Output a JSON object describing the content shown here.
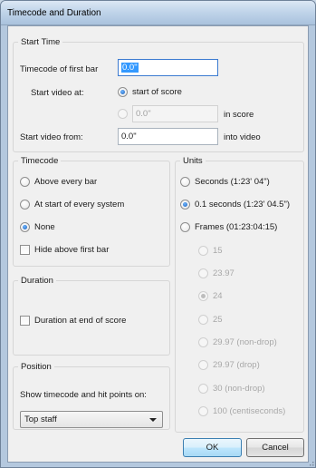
{
  "window": {
    "title": "Timecode and Duration"
  },
  "start_time": {
    "group_label": "Start Time",
    "timecode_label": "Timecode of first bar",
    "timecode_value": "0.0\"",
    "start_video_at_label": "Start video at:",
    "opt_start_of_score": "start of score",
    "opt_offset_value": "0.0\"",
    "opt_offset_suffix": "in score",
    "start_video_from_label": "Start video from:",
    "start_video_from_value": "0.0\"",
    "start_video_from_suffix": "into video"
  },
  "timecode": {
    "group_label": "Timecode",
    "options": [
      "Above every bar",
      "At start of every system",
      "None"
    ],
    "selected": "None",
    "hide_above_first_bar": "Hide above first bar"
  },
  "duration": {
    "group_label": "Duration",
    "at_end_of_score": "Duration at end of score"
  },
  "position": {
    "group_label": "Position",
    "show_label": "Show timecode and hit points on:",
    "selected_value": "Top staff"
  },
  "units": {
    "group_label": "Units",
    "seconds": "Seconds (1:23' 04\")",
    "tenth_seconds": "0.1 seconds (1:23' 04.5\")",
    "frames": "Frames (01:23:04:15)",
    "selected": "0.1 seconds (1:23' 04.5\")",
    "frame_rates": [
      "15",
      "23.97",
      "24",
      "25",
      "29.97 (non-drop)",
      "29.97 (drop)",
      "30 (non-drop)",
      "100 (centiseconds)"
    ],
    "frame_rate_selected": "24"
  },
  "buttons": {
    "ok": "OK",
    "cancel": "Cancel"
  },
  "colors": {
    "accent": "#3399ff",
    "titlebar": "#c1d5ea",
    "frame": "#b4c8de"
  }
}
